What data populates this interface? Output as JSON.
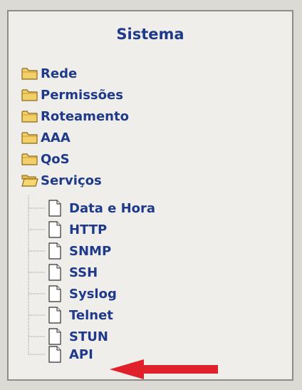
{
  "panel": {
    "title": "Sistema"
  },
  "folders": [
    {
      "label": "Rede",
      "icon": "folder-closed-icon"
    },
    {
      "label": "Permissões",
      "icon": "folder-closed-icon"
    },
    {
      "label": "Roteamento",
      "icon": "folder-closed-icon"
    },
    {
      "label": "AAA",
      "icon": "folder-closed-icon"
    },
    {
      "label": "QoS",
      "icon": "folder-closed-icon"
    },
    {
      "label": "Serviços",
      "icon": "folder-open-icon"
    }
  ],
  "servicos_children": [
    {
      "label": "Data e Hora",
      "icon": "page-icon"
    },
    {
      "label": "HTTP",
      "icon": "page-icon"
    },
    {
      "label": "SNMP",
      "icon": "page-icon"
    },
    {
      "label": "SSH",
      "icon": "page-icon"
    },
    {
      "label": "Syslog",
      "icon": "page-icon"
    },
    {
      "label": "Telnet",
      "icon": "page-icon"
    },
    {
      "label": "STUN",
      "icon": "page-icon"
    },
    {
      "label": "API",
      "icon": "page-icon"
    }
  ],
  "annotation": {
    "arrow_color": "#e0202a",
    "points_to": "API"
  },
  "colors": {
    "link": "#1f3a8a",
    "folder": "#e8c35a",
    "panel_bg": "#f0eeea"
  }
}
